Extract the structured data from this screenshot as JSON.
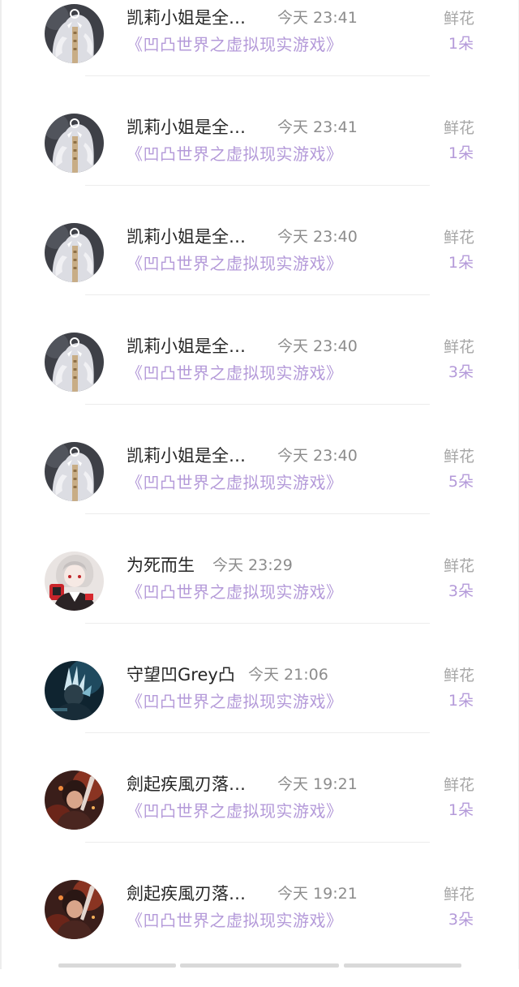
{
  "gift_rows": [
    {
      "name": "凯莉小姐是全…",
      "time": "今天 23:41",
      "book": "《凹凸世界之虚拟现实游戏》",
      "gift_label": "鲜花",
      "gift_count": "1朵",
      "avatar": "white-hair-character-avatar"
    },
    {
      "name": "凯莉小姐是全…",
      "time": "今天 23:41",
      "book": "《凹凸世界之虚拟现实游戏》",
      "gift_label": "鲜花",
      "gift_count": "1朵",
      "avatar": "white-hair-character-avatar"
    },
    {
      "name": "凯莉小姐是全…",
      "time": "今天 23:40",
      "book": "《凹凸世界之虚拟现实游戏》",
      "gift_label": "鲜花",
      "gift_count": "1朵",
      "avatar": "white-hair-character-avatar"
    },
    {
      "name": "凯莉小姐是全…",
      "time": "今天 23:40",
      "book": "《凹凸世界之虚拟现实游戏》",
      "gift_label": "鲜花",
      "gift_count": "3朵",
      "avatar": "white-hair-character-avatar"
    },
    {
      "name": "凯莉小姐是全…",
      "time": "今天 23:40",
      "book": "《凹凸世界之虚拟现实游戏》",
      "gift_label": "鲜花",
      "gift_count": "5朵",
      "avatar": "white-hair-character-avatar"
    },
    {
      "name": "为死而生",
      "time": "今天 23:29",
      "book": "《凹凸世界之虚拟现实游戏》",
      "gift_label": "鲜花",
      "gift_count": "3朵",
      "avatar": "red-white-character-avatar"
    },
    {
      "name": "守望凹Grey凸",
      "time": "今天 21:06",
      "book": "《凹凸世界之虚拟现实游戏》",
      "gift_label": "鲜花",
      "gift_count": "1朵",
      "avatar": "dark-blue-character-avatar"
    },
    {
      "name": "劍起疾風刃落…",
      "time": "今天 19:21",
      "book": "《凹凸世界之虚拟现实游戏》",
      "gift_label": "鲜花",
      "gift_count": "1朵",
      "avatar": "fiery-red-character-avatar"
    },
    {
      "name": "劍起疾風刃落…",
      "time": "今天 19:21",
      "book": "《凹凸世界之虚拟现实游戏》",
      "gift_label": "鲜花",
      "gift_count": "3朵",
      "avatar": "fiery-red-character-avatar"
    }
  ],
  "colors": {
    "name": "#262626",
    "time": "#8c8c8c",
    "book_link": "#b49ad9",
    "gift_label": "#a6a6a6",
    "gift_count": "#b49ad9",
    "divider": "#ececec"
  }
}
